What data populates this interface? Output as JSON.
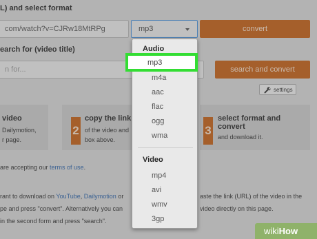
{
  "header": {
    "select_format_label": "L) and select format",
    "search_label": "earch for (video title)"
  },
  "url_input": {
    "value": "com/watch?v=CJRw18MtRPg"
  },
  "format_select": {
    "value": "mp3"
  },
  "convert_button": "convert",
  "search_input": {
    "placeholder": "n for..."
  },
  "search_convert_button": "search and convert",
  "settings_button": "settings",
  "steps": [
    {
      "title": "video",
      "lines": [
        "Dailymotion,",
        "r page."
      ]
    },
    {
      "number": "2",
      "title": "copy the link",
      "lines": [
        "of the video and",
        "box above."
      ]
    },
    {
      "number": "3",
      "title_lines": [
        "select format and",
        "convert"
      ],
      "lines": [
        "and download it."
      ]
    }
  ],
  "terms": {
    "before": "are accepting our ",
    "link": "terms of use",
    "after": "."
  },
  "instructions": {
    "line1_a": "rant to download on ",
    "youtube": "YouTube",
    "comma": ", ",
    "dailymotion": "Dailymotion",
    "line1_b": " or",
    "line1_c": "aste the link (URL) of the video in the",
    "line2_a": "pe and press \"convert\". Alternatively you can",
    "line2_b": "video directly on this page.",
    "line3": "in the second form and press \"search\"."
  },
  "dropdown": {
    "groups": [
      {
        "label": "Audio",
        "options": [
          "mp3",
          "m4a",
          "aac",
          "flac",
          "ogg",
          "wma"
        ]
      },
      {
        "label": "Video",
        "options": [
          "mp4",
          "avi",
          "wmv",
          "3gp"
        ]
      }
    ],
    "selected": "mp3"
  },
  "watermark": {
    "wiki": "wiki",
    "how": "How"
  },
  "colors": {
    "accent": "#c2621a",
    "highlight": "#33dd33",
    "link": "#2f64a8"
  }
}
